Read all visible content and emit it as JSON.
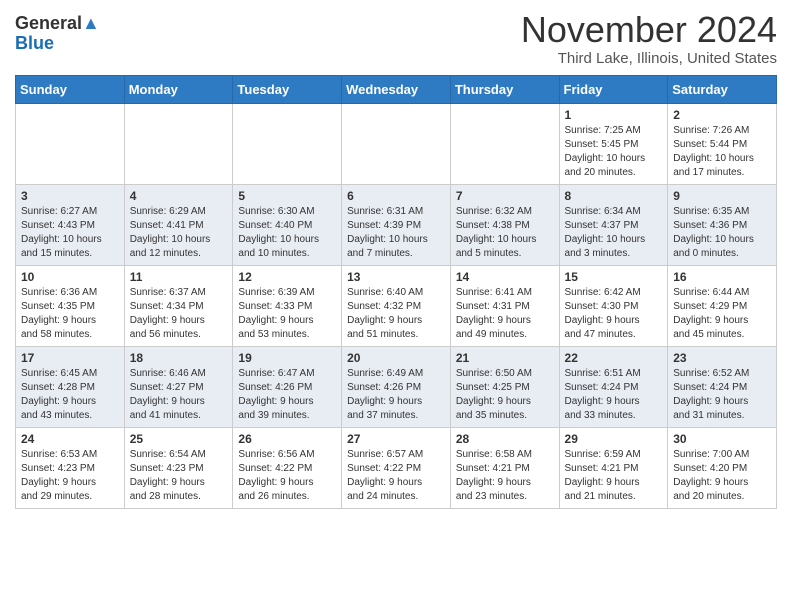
{
  "header": {
    "logo_general": "General",
    "logo_blue": "Blue",
    "month": "November 2024",
    "location": "Third Lake, Illinois, United States"
  },
  "weekdays": [
    "Sunday",
    "Monday",
    "Tuesday",
    "Wednesday",
    "Thursday",
    "Friday",
    "Saturday"
  ],
  "weeks": [
    {
      "days": [
        {
          "num": "",
          "info": ""
        },
        {
          "num": "",
          "info": ""
        },
        {
          "num": "",
          "info": ""
        },
        {
          "num": "",
          "info": ""
        },
        {
          "num": "",
          "info": ""
        },
        {
          "num": "1",
          "info": "Sunrise: 7:25 AM\nSunset: 5:45 PM\nDaylight: 10 hours\nand 20 minutes."
        },
        {
          "num": "2",
          "info": "Sunrise: 7:26 AM\nSunset: 5:44 PM\nDaylight: 10 hours\nand 17 minutes."
        }
      ]
    },
    {
      "days": [
        {
          "num": "3",
          "info": "Sunrise: 6:27 AM\nSunset: 4:43 PM\nDaylight: 10 hours\nand 15 minutes."
        },
        {
          "num": "4",
          "info": "Sunrise: 6:29 AM\nSunset: 4:41 PM\nDaylight: 10 hours\nand 12 minutes."
        },
        {
          "num": "5",
          "info": "Sunrise: 6:30 AM\nSunset: 4:40 PM\nDaylight: 10 hours\nand 10 minutes."
        },
        {
          "num": "6",
          "info": "Sunrise: 6:31 AM\nSunset: 4:39 PM\nDaylight: 10 hours\nand 7 minutes."
        },
        {
          "num": "7",
          "info": "Sunrise: 6:32 AM\nSunset: 4:38 PM\nDaylight: 10 hours\nand 5 minutes."
        },
        {
          "num": "8",
          "info": "Sunrise: 6:34 AM\nSunset: 4:37 PM\nDaylight: 10 hours\nand 3 minutes."
        },
        {
          "num": "9",
          "info": "Sunrise: 6:35 AM\nSunset: 4:36 PM\nDaylight: 10 hours\nand 0 minutes."
        }
      ]
    },
    {
      "days": [
        {
          "num": "10",
          "info": "Sunrise: 6:36 AM\nSunset: 4:35 PM\nDaylight: 9 hours\nand 58 minutes."
        },
        {
          "num": "11",
          "info": "Sunrise: 6:37 AM\nSunset: 4:34 PM\nDaylight: 9 hours\nand 56 minutes."
        },
        {
          "num": "12",
          "info": "Sunrise: 6:39 AM\nSunset: 4:33 PM\nDaylight: 9 hours\nand 53 minutes."
        },
        {
          "num": "13",
          "info": "Sunrise: 6:40 AM\nSunset: 4:32 PM\nDaylight: 9 hours\nand 51 minutes."
        },
        {
          "num": "14",
          "info": "Sunrise: 6:41 AM\nSunset: 4:31 PM\nDaylight: 9 hours\nand 49 minutes."
        },
        {
          "num": "15",
          "info": "Sunrise: 6:42 AM\nSunset: 4:30 PM\nDaylight: 9 hours\nand 47 minutes."
        },
        {
          "num": "16",
          "info": "Sunrise: 6:44 AM\nSunset: 4:29 PM\nDaylight: 9 hours\nand 45 minutes."
        }
      ]
    },
    {
      "days": [
        {
          "num": "17",
          "info": "Sunrise: 6:45 AM\nSunset: 4:28 PM\nDaylight: 9 hours\nand 43 minutes."
        },
        {
          "num": "18",
          "info": "Sunrise: 6:46 AM\nSunset: 4:27 PM\nDaylight: 9 hours\nand 41 minutes."
        },
        {
          "num": "19",
          "info": "Sunrise: 6:47 AM\nSunset: 4:26 PM\nDaylight: 9 hours\nand 39 minutes."
        },
        {
          "num": "20",
          "info": "Sunrise: 6:49 AM\nSunset: 4:26 PM\nDaylight: 9 hours\nand 37 minutes."
        },
        {
          "num": "21",
          "info": "Sunrise: 6:50 AM\nSunset: 4:25 PM\nDaylight: 9 hours\nand 35 minutes."
        },
        {
          "num": "22",
          "info": "Sunrise: 6:51 AM\nSunset: 4:24 PM\nDaylight: 9 hours\nand 33 minutes."
        },
        {
          "num": "23",
          "info": "Sunrise: 6:52 AM\nSunset: 4:24 PM\nDaylight: 9 hours\nand 31 minutes."
        }
      ]
    },
    {
      "days": [
        {
          "num": "24",
          "info": "Sunrise: 6:53 AM\nSunset: 4:23 PM\nDaylight: 9 hours\nand 29 minutes."
        },
        {
          "num": "25",
          "info": "Sunrise: 6:54 AM\nSunset: 4:23 PM\nDaylight: 9 hours\nand 28 minutes."
        },
        {
          "num": "26",
          "info": "Sunrise: 6:56 AM\nSunset: 4:22 PM\nDaylight: 9 hours\nand 26 minutes."
        },
        {
          "num": "27",
          "info": "Sunrise: 6:57 AM\nSunset: 4:22 PM\nDaylight: 9 hours\nand 24 minutes."
        },
        {
          "num": "28",
          "info": "Sunrise: 6:58 AM\nSunset: 4:21 PM\nDaylight: 9 hours\nand 23 minutes."
        },
        {
          "num": "29",
          "info": "Sunrise: 6:59 AM\nSunset: 4:21 PM\nDaylight: 9 hours\nand 21 minutes."
        },
        {
          "num": "30",
          "info": "Sunrise: 7:00 AM\nSunset: 4:20 PM\nDaylight: 9 hours\nand 20 minutes."
        }
      ]
    }
  ]
}
